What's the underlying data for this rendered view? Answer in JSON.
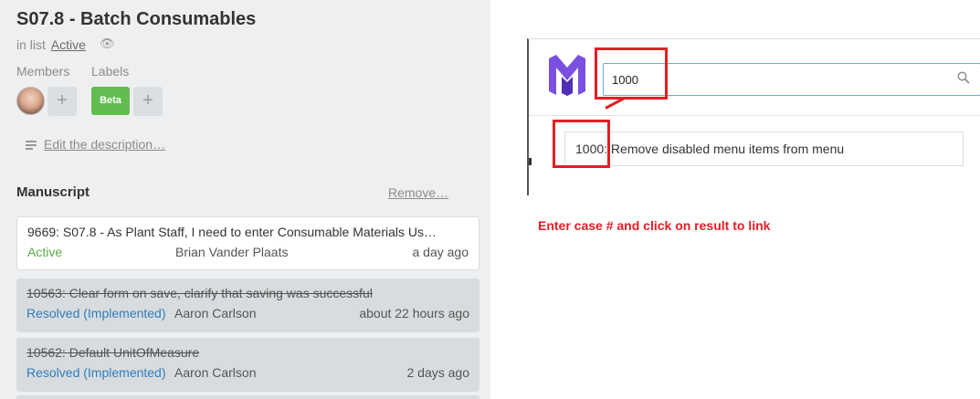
{
  "card": {
    "title": "S07.8 - Batch Consumables",
    "in_list_prefix": "in list",
    "list_name": "Active",
    "members_label": "Members",
    "labels_label": "Labels",
    "label_beta": "Beta",
    "plus": "+",
    "edit_description": "Edit the description…"
  },
  "manuscript": {
    "heading": "Manuscript",
    "remove_label": "Remove…",
    "items": [
      {
        "title": "9669: S07.8 - As Plant Staff, I need to enter Consumable Materials Us…",
        "status": "Active",
        "person": "Brian Vander Plaats",
        "when": "a day ago"
      },
      {
        "title": "10563: Clear form on save, clarify that saving was successful",
        "status": "Resolved (Implemented)",
        "person": "Aaron Carlson",
        "when": "about 22 hours ago"
      },
      {
        "title": "10562: Default UnitOfMeasure",
        "status": "Resolved (Implemented)",
        "person": "Aaron Carlson",
        "when": "2 days ago"
      }
    ]
  },
  "search": {
    "value": "1000",
    "result_id": "1000",
    "result_text": ": Remove disabled menu items from menu"
  },
  "annotation": {
    "instruction": "Enter case # and click on result to link",
    "color": "#e31e24"
  },
  "colors": {
    "label_green": "#61bd4f",
    "status_active": "#5aac44",
    "status_resolved": "#2e7dbd",
    "logo_purple": "#7b4fe0"
  }
}
